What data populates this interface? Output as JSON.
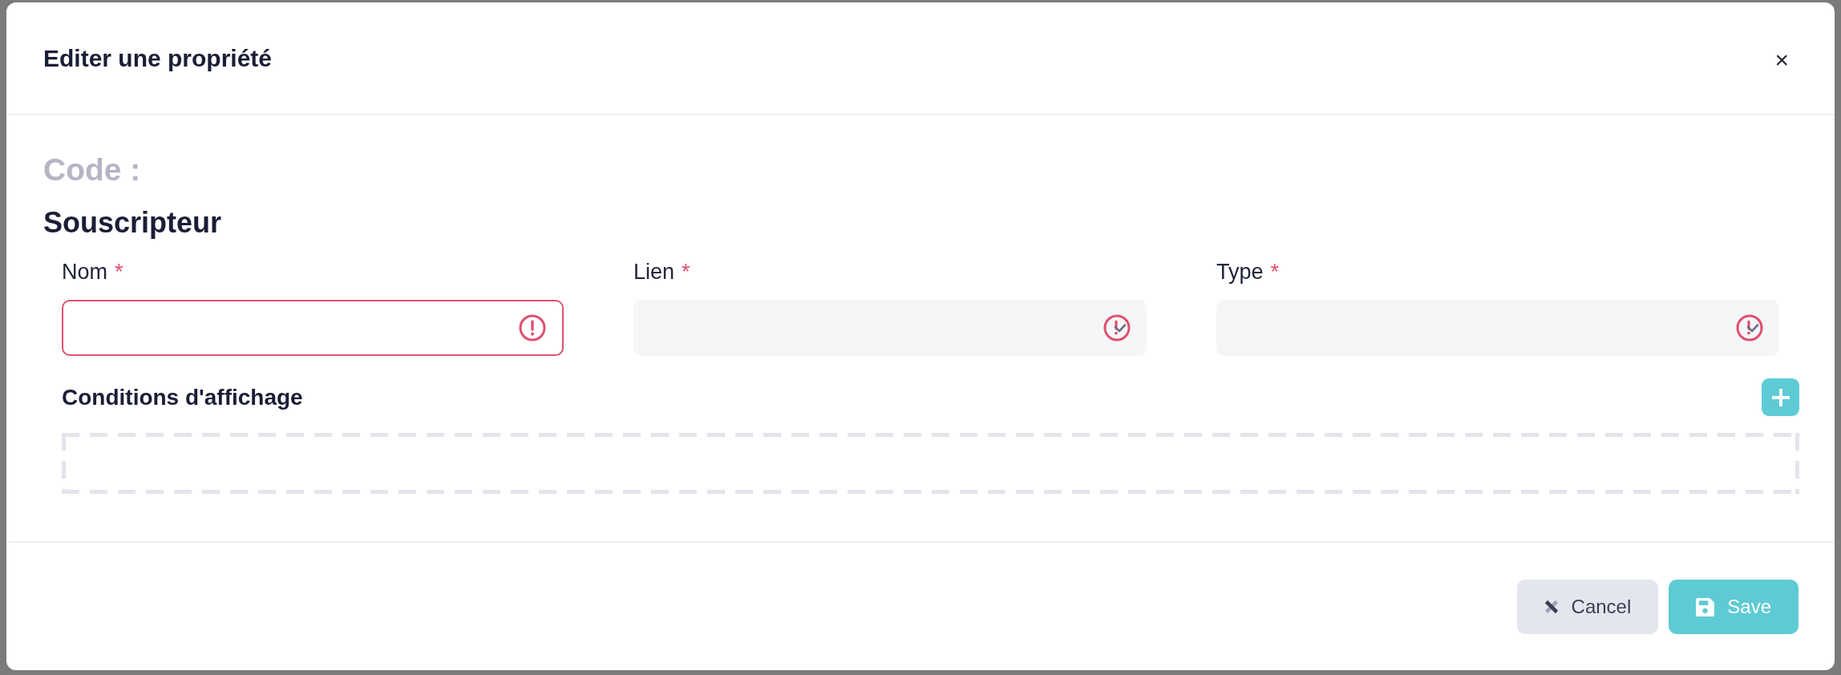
{
  "dialog": {
    "title": "Editer une propriété",
    "close": "×"
  },
  "code_label": "Code :",
  "section": {
    "title": "Souscripteur",
    "fields": [
      {
        "label": "Nom",
        "required_mark": "*",
        "kind": "text",
        "error": true
      },
      {
        "label": "Lien",
        "required_mark": "*",
        "kind": "select",
        "error": true
      },
      {
        "label": "Type",
        "required_mark": "*",
        "kind": "select",
        "error": true
      }
    ],
    "conditions": {
      "title": "Conditions d'affichage"
    }
  },
  "footer": {
    "buttons": [
      {
        "label": "Cancel",
        "kind": "cancel"
      },
      {
        "label": "Save",
        "kind": "save"
      }
    ]
  }
}
